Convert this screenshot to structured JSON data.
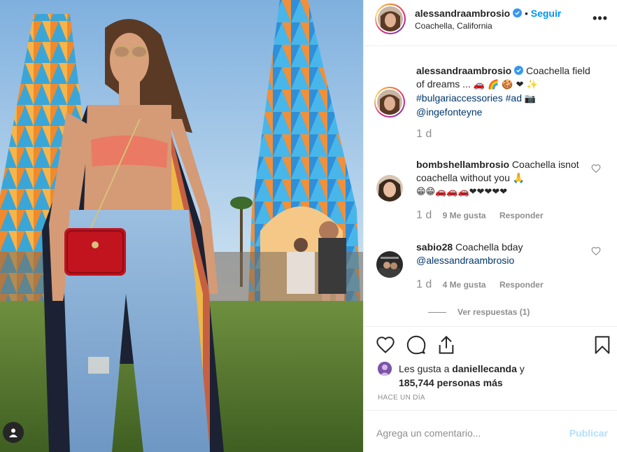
{
  "post": {
    "author": "alessandraambrosio",
    "follow_separator": "•",
    "follow_label": "Seguir",
    "location": "Coachella, California",
    "more_label": "•••"
  },
  "caption": {
    "user": "alessandraambrosio",
    "text": "Coachella field of dreams ... ",
    "emojis": "🚗 🌈 🍪 ❤ ✨",
    "hashtag1": "#bulgariaccessories",
    "hashtag2": "#ad",
    "camera_emoji": "📷",
    "mention": "@ingefonteyne",
    "time": "1 d"
  },
  "comments": [
    {
      "user": "bombshellambrosio",
      "text": "Coachella isnot coachella without you 🙏",
      "emojis": "😁😁🚗🚗🚗❤❤❤❤❤",
      "time": "1 d",
      "likes": "9 Me gusta",
      "reply": "Responder"
    },
    {
      "user": "sabio28",
      "text": "Coachella bday",
      "mention": "@alessandraambrosio",
      "time": "1 d",
      "likes": "4 Me gusta",
      "reply": "Responder"
    }
  ],
  "view_replies": "Ver respuestas (1)",
  "likes": {
    "prefix": "Les gusta a ",
    "user": "daniellecanda",
    "and": " y",
    "count": "185,744 personas más"
  },
  "time_ago": "HACE UN DÍA",
  "add_comment": {
    "placeholder": "Agrega un comentario...",
    "post_label": "Publicar"
  },
  "icons": {
    "verified": "verified-badge-icon",
    "like": "heart-icon",
    "comment": "comment-icon",
    "share": "share-icon",
    "save": "bookmark-icon",
    "more": "more-options-icon",
    "tag": "user-tag-icon"
  },
  "colors": {
    "follow": "#0095f6",
    "link": "#00376b",
    "secondary_text": "#8e8e8e",
    "publish_disabled": "#b2dffc",
    "heart_red": "#ed4956"
  }
}
